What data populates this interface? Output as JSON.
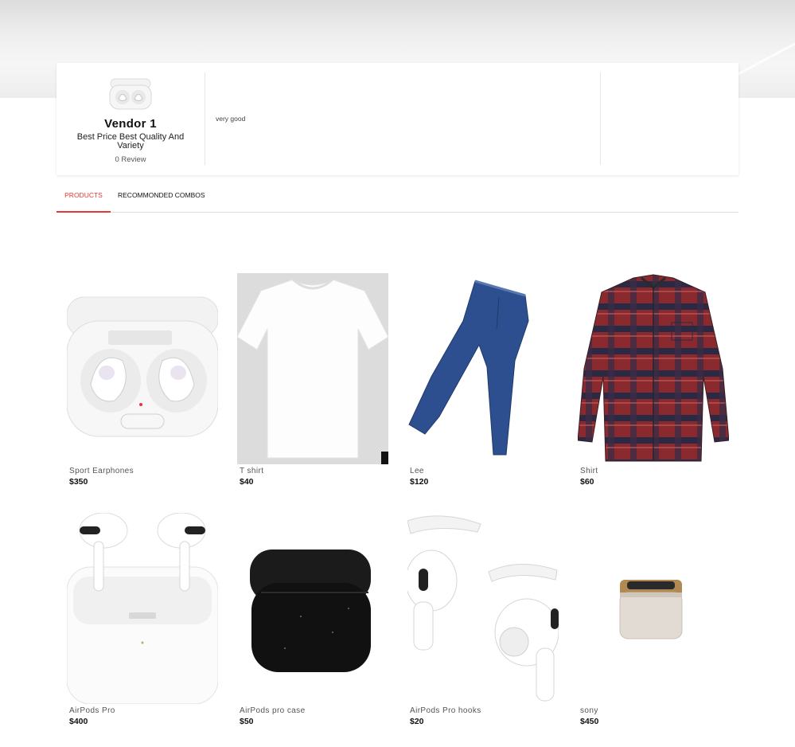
{
  "vendor": {
    "name": "Vendor 1",
    "tagline": "Best Price Best Quality And Variety",
    "reviews": "0 Review",
    "description": "very good"
  },
  "tabs": [
    {
      "label": "PRODUCTS",
      "active": true
    },
    {
      "label": "RECOMMONDED COMBOS",
      "active": false
    }
  ],
  "colors": {
    "accent": "#e53935"
  },
  "products": [
    {
      "name": "Sport Earphones",
      "price": "$350",
      "icon": "earbuds-case-image"
    },
    {
      "name": "T shirt",
      "price": "$40",
      "icon": "tshirt-image"
    },
    {
      "name": "Lee",
      "price": "$120",
      "icon": "jeans-image"
    },
    {
      "name": "Shirt",
      "price": "$60",
      "icon": "plaid-shirt-image"
    },
    {
      "name": "AirPods Pro",
      "price": "$400",
      "icon": "airpods-pro-image"
    },
    {
      "name": "AirPods pro case",
      "price": "$50",
      "icon": "airpods-case-cover-image"
    },
    {
      "name": "AirPods Pro hooks",
      "price": "$20",
      "icon": "airpods-hooks-image"
    },
    {
      "name": "sony",
      "price": "$450",
      "icon": "sony-earbuds-image"
    }
  ]
}
